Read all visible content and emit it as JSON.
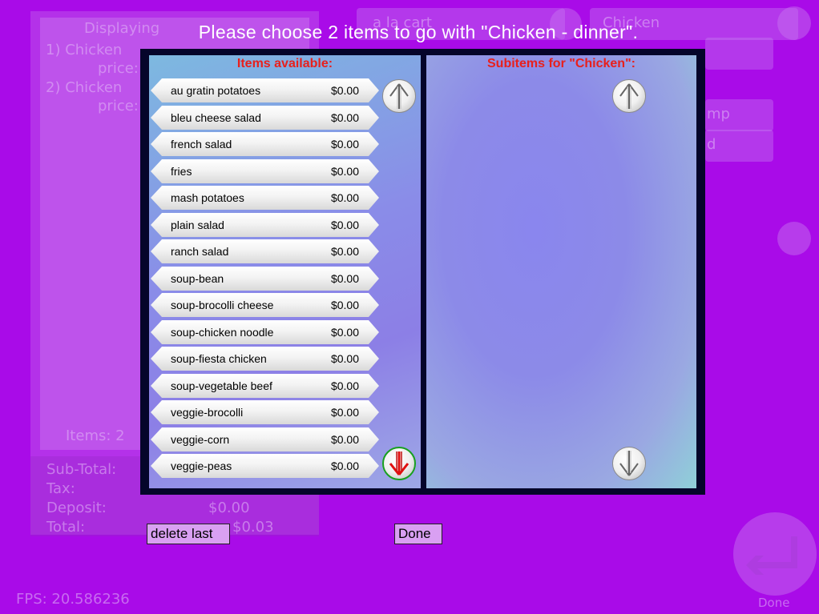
{
  "dialog": {
    "title": "Please choose 2 items to go with \"Chicken - dinner\".",
    "left_title": "Items available:",
    "right_title": "Subitems for \"Chicken\":"
  },
  "items": [
    {
      "name": "au gratin potatoes",
      "price": "$0.00"
    },
    {
      "name": "bleu cheese salad",
      "price": "$0.00"
    },
    {
      "name": "french salad",
      "price": "$0.00"
    },
    {
      "name": "fries",
      "price": "$0.00"
    },
    {
      "name": "mash potatoes",
      "price": "$0.00"
    },
    {
      "name": "plain salad",
      "price": "$0.00"
    },
    {
      "name": "ranch salad",
      "price": "$0.00"
    },
    {
      "name": "soup-bean",
      "price": "$0.00"
    },
    {
      "name": "soup-brocolli cheese",
      "price": "$0.00"
    },
    {
      "name": "soup-chicken noodle",
      "price": "$0.00"
    },
    {
      "name": "soup-fiesta chicken",
      "price": "$0.00"
    },
    {
      "name": "soup-vegetable beef",
      "price": "$0.00"
    },
    {
      "name": "veggie-brocolli",
      "price": "$0.00"
    },
    {
      "name": "veggie-corn",
      "price": "$0.00"
    },
    {
      "name": "veggie-peas",
      "price": "$0.00"
    }
  ],
  "buttons": {
    "delete_last": "delete last",
    "done": "Done"
  },
  "background": {
    "displaying": "Displaying",
    "line1": "1) Chicken",
    "line1b": "price:",
    "line2": "2) Chicken",
    "line2b": "price:",
    "items_count": "Items: 2",
    "subtotal_label": "Sub-Total:",
    "tax_label": "Tax:",
    "deposit_label": "Deposit:",
    "deposit_value": "$0.00",
    "total_label": "Total:",
    "total_value": "$0.03",
    "chip1": "a la cart",
    "chip2": "Chicken",
    "chip3": "mp",
    "chip4": "d",
    "fps": "FPS: 20.586236",
    "done_label": "Done"
  },
  "colors": {
    "background": "#a90be8",
    "frame": "#05052a",
    "pane_title": "#e8201c",
    "button": "#d9a0f2",
    "active_arrow": "#e01010"
  },
  "icons": {
    "scroll_up": "up-arrow-icon",
    "scroll_down": "down-arrow-icon",
    "enter": "enter-arrow-icon"
  }
}
